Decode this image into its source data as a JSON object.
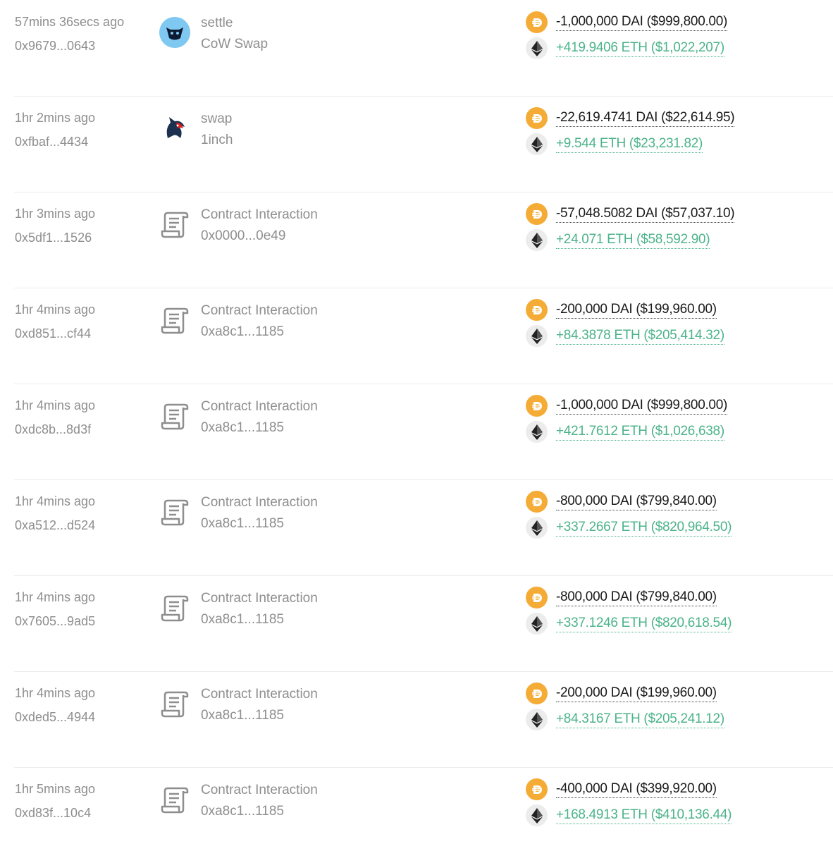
{
  "colors": {
    "dai": "#f5ac37",
    "eth_text": "#4cb38b",
    "muted": "#8e8e8e"
  },
  "icons": {
    "dai": "dai-token-icon",
    "eth": "eth-token-icon",
    "contract": "contract-scroll-icon",
    "cowswap": "cowswap-logo-icon",
    "oneinch": "1inch-unicorn-logo-icon"
  },
  "rows": [
    {
      "time": "57mins 36secs ago",
      "hash": "0x9679...0643",
      "icon": "cowswap",
      "name": "settle",
      "sub": "CoW Swap",
      "out": "-1,000,000 DAI ($999,800.00)",
      "in": "+419.9406 ETH ($1,022,207)"
    },
    {
      "time": "1hr 2mins ago",
      "hash": "0xfbaf...4434",
      "icon": "oneinch",
      "name": "swap",
      "sub": "1inch",
      "out": "-22,619.4741 DAI ($22,614.95)",
      "in": "+9.544 ETH ($23,231.82)"
    },
    {
      "time": "1hr 3mins ago",
      "hash": "0x5df1...1526",
      "icon": "contract",
      "name": "Contract Interaction",
      "sub": "0x0000...0e49",
      "out": "-57,048.5082 DAI ($57,037.10)",
      "in": "+24.071 ETH ($58,592.90)"
    },
    {
      "time": "1hr 4mins ago",
      "hash": "0xd851...cf44",
      "icon": "contract",
      "name": "Contract Interaction",
      "sub": "0xa8c1...1185",
      "out": "-200,000 DAI ($199,960.00)",
      "in": "+84.3878 ETH ($205,414.32)"
    },
    {
      "time": "1hr 4mins ago",
      "hash": "0xdc8b...8d3f",
      "icon": "contract",
      "name": "Contract Interaction",
      "sub": "0xa8c1...1185",
      "out": "-1,000,000 DAI ($999,800.00)",
      "in": "+421.7612 ETH ($1,026,638)"
    },
    {
      "time": "1hr 4mins ago",
      "hash": "0xa512...d524",
      "icon": "contract",
      "name": "Contract Interaction",
      "sub": "0xa8c1...1185",
      "out": "-800,000 DAI ($799,840.00)",
      "in": "+337.2667 ETH ($820,964.50)"
    },
    {
      "time": "1hr 4mins ago",
      "hash": "0x7605...9ad5",
      "icon": "contract",
      "name": "Contract Interaction",
      "sub": "0xa8c1...1185",
      "out": "-800,000 DAI ($799,840.00)",
      "in": "+337.1246 ETH ($820,618.54)"
    },
    {
      "time": "1hr 4mins ago",
      "hash": "0xded5...4944",
      "icon": "contract",
      "name": "Contract Interaction",
      "sub": "0xa8c1...1185",
      "out": "-200,000 DAI ($199,960.00)",
      "in": "+84.3167 ETH ($205,241.12)"
    },
    {
      "time": "1hr 5mins ago",
      "hash": "0xd83f...10c4",
      "icon": "contract",
      "name": "Contract Interaction",
      "sub": "0xa8c1...1185",
      "out": "-400,000 DAI ($399,920.00)",
      "in": "+168.4913 ETH ($410,136.44)"
    }
  ]
}
